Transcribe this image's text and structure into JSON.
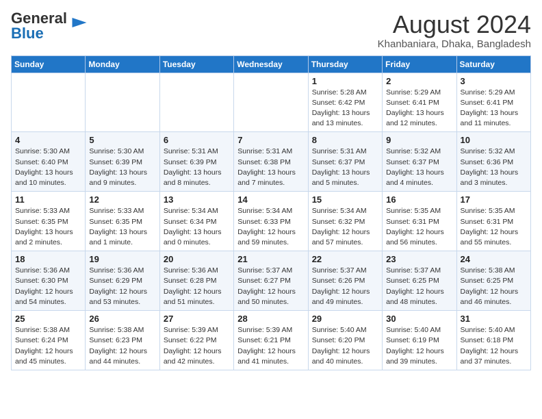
{
  "header": {
    "logo_general": "General",
    "logo_blue": "Blue",
    "month_year": "August 2024",
    "location": "Khanbaniara, Dhaka, Bangladesh"
  },
  "days_of_week": [
    "Sunday",
    "Monday",
    "Tuesday",
    "Wednesday",
    "Thursday",
    "Friday",
    "Saturday"
  ],
  "weeks": [
    [
      {
        "day": "",
        "sunrise": "",
        "sunset": "",
        "daylight": ""
      },
      {
        "day": "",
        "sunrise": "",
        "sunset": "",
        "daylight": ""
      },
      {
        "day": "",
        "sunrise": "",
        "sunset": "",
        "daylight": ""
      },
      {
        "day": "",
        "sunrise": "",
        "sunset": "",
        "daylight": ""
      },
      {
        "day": "1",
        "sunrise": "Sunrise: 5:28 AM",
        "sunset": "Sunset: 6:42 PM",
        "daylight": "Daylight: 13 hours and 13 minutes."
      },
      {
        "day": "2",
        "sunrise": "Sunrise: 5:29 AM",
        "sunset": "Sunset: 6:41 PM",
        "daylight": "Daylight: 13 hours and 12 minutes."
      },
      {
        "day": "3",
        "sunrise": "Sunrise: 5:29 AM",
        "sunset": "Sunset: 6:41 PM",
        "daylight": "Daylight: 13 hours and 11 minutes."
      }
    ],
    [
      {
        "day": "4",
        "sunrise": "Sunrise: 5:30 AM",
        "sunset": "Sunset: 6:40 PM",
        "daylight": "Daylight: 13 hours and 10 minutes."
      },
      {
        "day": "5",
        "sunrise": "Sunrise: 5:30 AM",
        "sunset": "Sunset: 6:39 PM",
        "daylight": "Daylight: 13 hours and 9 minutes."
      },
      {
        "day": "6",
        "sunrise": "Sunrise: 5:31 AM",
        "sunset": "Sunset: 6:39 PM",
        "daylight": "Daylight: 13 hours and 8 minutes."
      },
      {
        "day": "7",
        "sunrise": "Sunrise: 5:31 AM",
        "sunset": "Sunset: 6:38 PM",
        "daylight": "Daylight: 13 hours and 7 minutes."
      },
      {
        "day": "8",
        "sunrise": "Sunrise: 5:31 AM",
        "sunset": "Sunset: 6:37 PM",
        "daylight": "Daylight: 13 hours and 5 minutes."
      },
      {
        "day": "9",
        "sunrise": "Sunrise: 5:32 AM",
        "sunset": "Sunset: 6:37 PM",
        "daylight": "Daylight: 13 hours and 4 minutes."
      },
      {
        "day": "10",
        "sunrise": "Sunrise: 5:32 AM",
        "sunset": "Sunset: 6:36 PM",
        "daylight": "Daylight: 13 hours and 3 minutes."
      }
    ],
    [
      {
        "day": "11",
        "sunrise": "Sunrise: 5:33 AM",
        "sunset": "Sunset: 6:35 PM",
        "daylight": "Daylight: 13 hours and 2 minutes."
      },
      {
        "day": "12",
        "sunrise": "Sunrise: 5:33 AM",
        "sunset": "Sunset: 6:35 PM",
        "daylight": "Daylight: 13 hours and 1 minute."
      },
      {
        "day": "13",
        "sunrise": "Sunrise: 5:34 AM",
        "sunset": "Sunset: 6:34 PM",
        "daylight": "Daylight: 13 hours and 0 minutes."
      },
      {
        "day": "14",
        "sunrise": "Sunrise: 5:34 AM",
        "sunset": "Sunset: 6:33 PM",
        "daylight": "Daylight: 12 hours and 59 minutes."
      },
      {
        "day": "15",
        "sunrise": "Sunrise: 5:34 AM",
        "sunset": "Sunset: 6:32 PM",
        "daylight": "Daylight: 12 hours and 57 minutes."
      },
      {
        "day": "16",
        "sunrise": "Sunrise: 5:35 AM",
        "sunset": "Sunset: 6:31 PM",
        "daylight": "Daylight: 12 hours and 56 minutes."
      },
      {
        "day": "17",
        "sunrise": "Sunrise: 5:35 AM",
        "sunset": "Sunset: 6:31 PM",
        "daylight": "Daylight: 12 hours and 55 minutes."
      }
    ],
    [
      {
        "day": "18",
        "sunrise": "Sunrise: 5:36 AM",
        "sunset": "Sunset: 6:30 PM",
        "daylight": "Daylight: 12 hours and 54 minutes."
      },
      {
        "day": "19",
        "sunrise": "Sunrise: 5:36 AM",
        "sunset": "Sunset: 6:29 PM",
        "daylight": "Daylight: 12 hours and 53 minutes."
      },
      {
        "day": "20",
        "sunrise": "Sunrise: 5:36 AM",
        "sunset": "Sunset: 6:28 PM",
        "daylight": "Daylight: 12 hours and 51 minutes."
      },
      {
        "day": "21",
        "sunrise": "Sunrise: 5:37 AM",
        "sunset": "Sunset: 6:27 PM",
        "daylight": "Daylight: 12 hours and 50 minutes."
      },
      {
        "day": "22",
        "sunrise": "Sunrise: 5:37 AM",
        "sunset": "Sunset: 6:26 PM",
        "daylight": "Daylight: 12 hours and 49 minutes."
      },
      {
        "day": "23",
        "sunrise": "Sunrise: 5:37 AM",
        "sunset": "Sunset: 6:25 PM",
        "daylight": "Daylight: 12 hours and 48 minutes."
      },
      {
        "day": "24",
        "sunrise": "Sunrise: 5:38 AM",
        "sunset": "Sunset: 6:25 PM",
        "daylight": "Daylight: 12 hours and 46 minutes."
      }
    ],
    [
      {
        "day": "25",
        "sunrise": "Sunrise: 5:38 AM",
        "sunset": "Sunset: 6:24 PM",
        "daylight": "Daylight: 12 hours and 45 minutes."
      },
      {
        "day": "26",
        "sunrise": "Sunrise: 5:38 AM",
        "sunset": "Sunset: 6:23 PM",
        "daylight": "Daylight: 12 hours and 44 minutes."
      },
      {
        "day": "27",
        "sunrise": "Sunrise: 5:39 AM",
        "sunset": "Sunset: 6:22 PM",
        "daylight": "Daylight: 12 hours and 42 minutes."
      },
      {
        "day": "28",
        "sunrise": "Sunrise: 5:39 AM",
        "sunset": "Sunset: 6:21 PM",
        "daylight": "Daylight: 12 hours and 41 minutes."
      },
      {
        "day": "29",
        "sunrise": "Sunrise: 5:40 AM",
        "sunset": "Sunset: 6:20 PM",
        "daylight": "Daylight: 12 hours and 40 minutes."
      },
      {
        "day": "30",
        "sunrise": "Sunrise: 5:40 AM",
        "sunset": "Sunset: 6:19 PM",
        "daylight": "Daylight: 12 hours and 39 minutes."
      },
      {
        "day": "31",
        "sunrise": "Sunrise: 5:40 AM",
        "sunset": "Sunset: 6:18 PM",
        "daylight": "Daylight: 12 hours and 37 minutes."
      }
    ]
  ]
}
